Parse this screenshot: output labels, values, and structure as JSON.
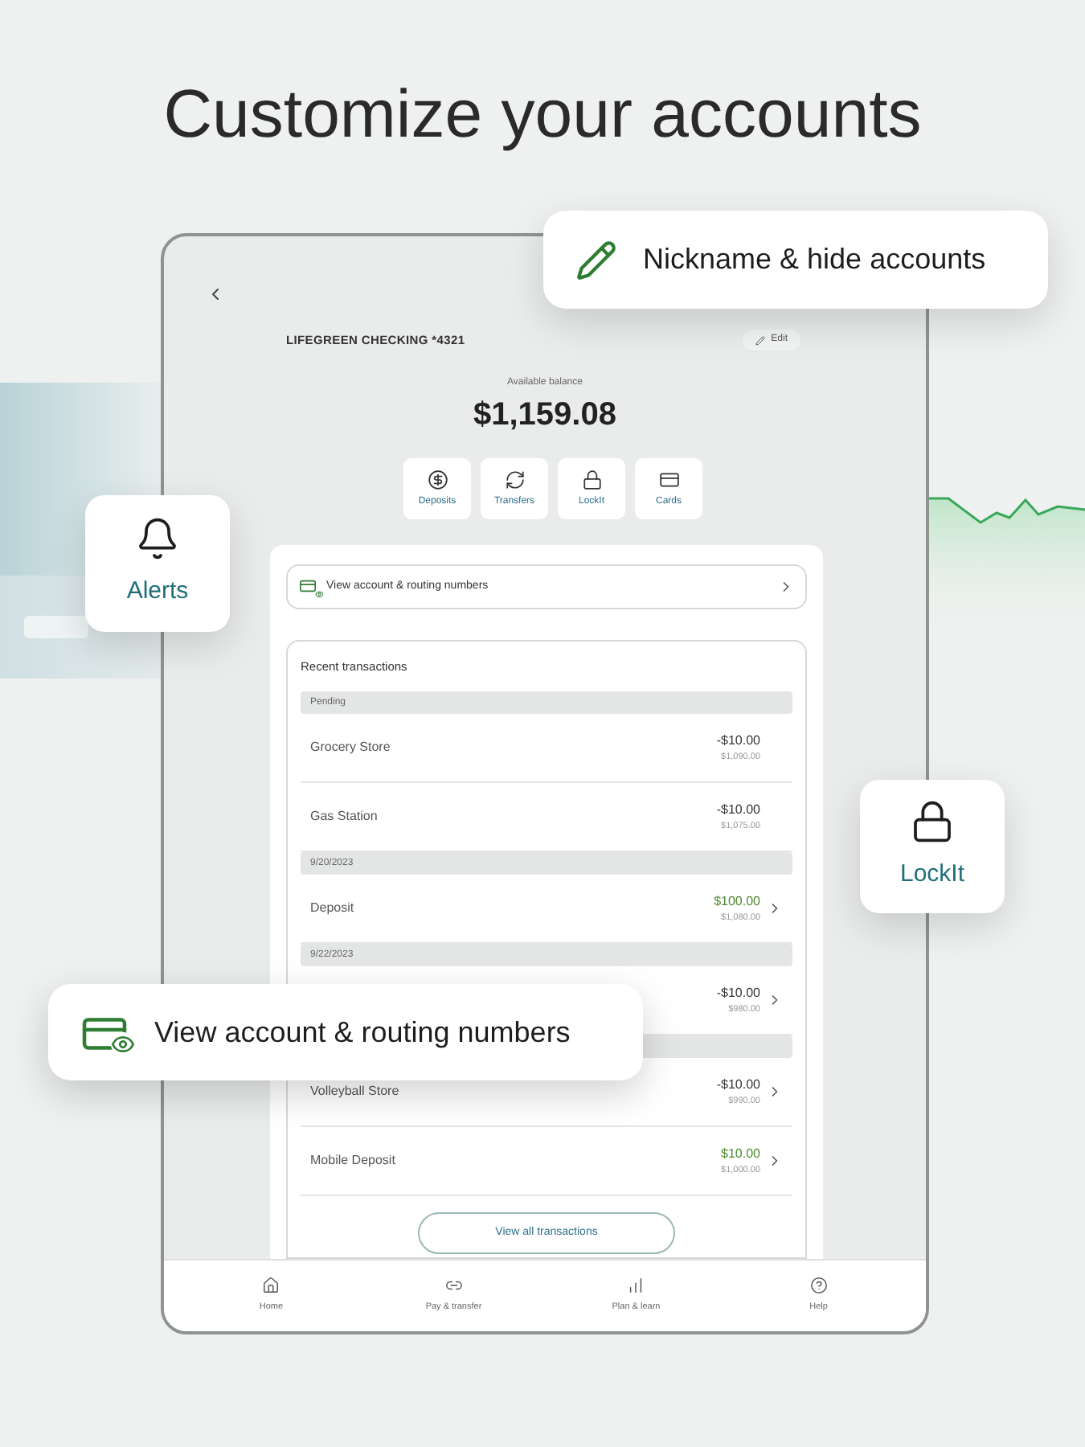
{
  "headline": "Customize your accounts",
  "account": {
    "name": "LIFEGREEN CHECKING *4321",
    "edit_label": "Edit",
    "balance_label": "Available balance",
    "balance": "$1,159.08"
  },
  "actions": [
    {
      "kind": "deposits",
      "label": "Deposits"
    },
    {
      "kind": "transfers",
      "label": "Transfers"
    },
    {
      "kind": "lockit",
      "label": "LockIt"
    },
    {
      "kind": "cards",
      "label": "Cards"
    }
  ],
  "routing_link": "View account & routing numbers",
  "transactions": {
    "title": "Recent transactions",
    "button": "View all transactions",
    "items": [
      {
        "kind": "header",
        "label": "Pending"
      },
      {
        "kind": "transaction",
        "name": "Grocery Store",
        "amount": "-$10.00",
        "balance": "$1,090.00",
        "credit": false,
        "chevron": false
      },
      {
        "kind": "transaction",
        "name": "Gas Station",
        "amount": "-$10.00",
        "balance": "$1,075.00",
        "credit": false,
        "chevron": false
      },
      {
        "kind": "header",
        "label": "9/20/2023"
      },
      {
        "kind": "transaction",
        "name": "Deposit",
        "amount": "$100.00",
        "balance": "$1,080.00",
        "credit": true,
        "chevron": true
      },
      {
        "kind": "header",
        "label": "9/22/2023"
      },
      {
        "kind": "transaction",
        "amount": "-$10.00",
        "balance": "$980.00",
        "credit": false,
        "chevron": true
      },
      {
        "kind": "header"
      },
      {
        "kind": "transaction",
        "name": "Volleyball Store",
        "amount": "-$10.00",
        "balance": "$990.00",
        "credit": false,
        "chevron": true
      },
      {
        "kind": "transaction",
        "name": "Mobile Deposit",
        "amount": "$10.00",
        "balance": "$1,000.00",
        "credit": true,
        "chevron": true
      }
    ]
  },
  "nav": [
    {
      "kind": "home",
      "label": "Home"
    },
    {
      "kind": "pay",
      "label": "Pay & transfer"
    },
    {
      "kind": "plan",
      "label": "Plan & learn"
    },
    {
      "kind": "help",
      "label": "Help"
    }
  ],
  "callouts": [
    {
      "kind": "nickname",
      "label": "Nickname & hide accounts"
    },
    {
      "kind": "alerts",
      "label": "Alerts"
    },
    {
      "kind": "lockit",
      "label": "LockIt"
    },
    {
      "kind": "routing",
      "label": "View account & routing numbers"
    }
  ]
}
